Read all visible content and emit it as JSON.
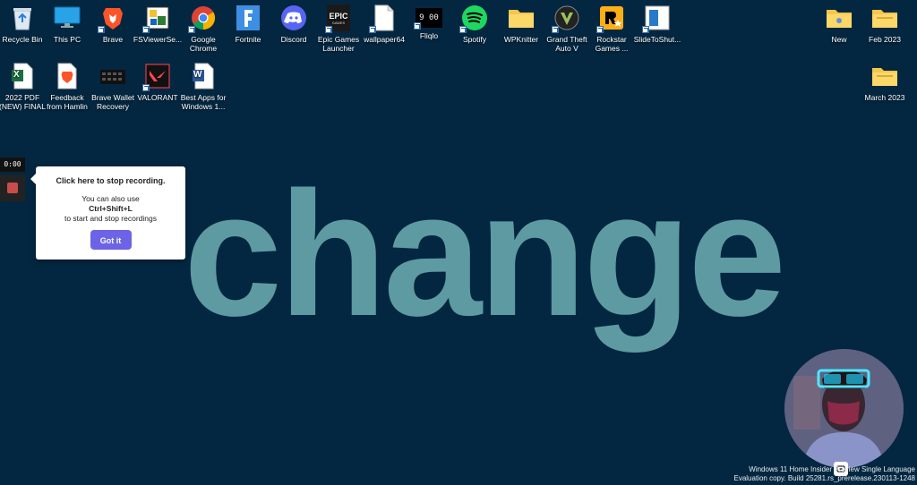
{
  "desktop_icons": [
    {
      "name": "recycle-bin",
      "label": "Recycle Bin"
    },
    {
      "name": "this-pc",
      "label": "This PC"
    },
    {
      "name": "brave",
      "label": "Brave"
    },
    {
      "name": "fsviewer",
      "label": "FSViewerSe..."
    },
    {
      "name": "google-chrome",
      "label": "Google Chrome"
    },
    {
      "name": "fortnite",
      "label": "Fortnite"
    },
    {
      "name": "discord",
      "label": "Discord"
    },
    {
      "name": "epic-games",
      "label": "Epic Games Launcher"
    },
    {
      "name": "wallpaper64",
      "label": "wallpaper64"
    },
    {
      "name": "fliqlo",
      "label": "Fliqlo"
    },
    {
      "name": "spotify",
      "label": "Spotify"
    },
    {
      "name": "wpknitter",
      "label": "WPKnitter"
    },
    {
      "name": "gta-v",
      "label": "Grand Theft Auto V"
    },
    {
      "name": "rockstar",
      "label": "Rockstar Games ..."
    },
    {
      "name": "slidetoshut",
      "label": "SlideToShut..."
    },
    {
      "name": "excel-2022",
      "label": "2022 PDF (NEW) FINAL"
    },
    {
      "name": "feedback-hamlin",
      "label": "Feedback from Hamlin"
    },
    {
      "name": "brave-wallet",
      "label": "Brave Wallet Recovery"
    },
    {
      "name": "valorant",
      "label": "VALORANT"
    },
    {
      "name": "best-apps",
      "label": "Best Apps for Windows 1..."
    },
    {
      "name": "folder-new",
      "label": "New"
    },
    {
      "name": "folder-feb-2023",
      "label": "Feb 2023"
    },
    {
      "name": "folder-march-2023",
      "label": "March 2023"
    }
  ],
  "icon_text": {
    "epic": "EPIC",
    "epic_sub": "GAMES",
    "fliqlo": "9 00",
    "excel": "X",
    "word": "W"
  },
  "wallpaper_text": "change",
  "recorder": {
    "timer": "0:00",
    "tooltip_title": "Click here to stop recording.",
    "tooltip_line1": "You can also use",
    "tooltip_shortcut": "Ctrl+Shift+L",
    "tooltip_line2": "to start and stop recordings",
    "got_it": "Got it"
  },
  "watermark": {
    "line1": "Windows 11 Home Insider Preview Single Language",
    "line2": "Evaluation copy. Build 25281.rs_prerelease.230113-1248"
  },
  "colors": {
    "desktop_bg": "#032741",
    "wallpaper_text": "#5e9aa2",
    "button": "#6c63e6"
  }
}
